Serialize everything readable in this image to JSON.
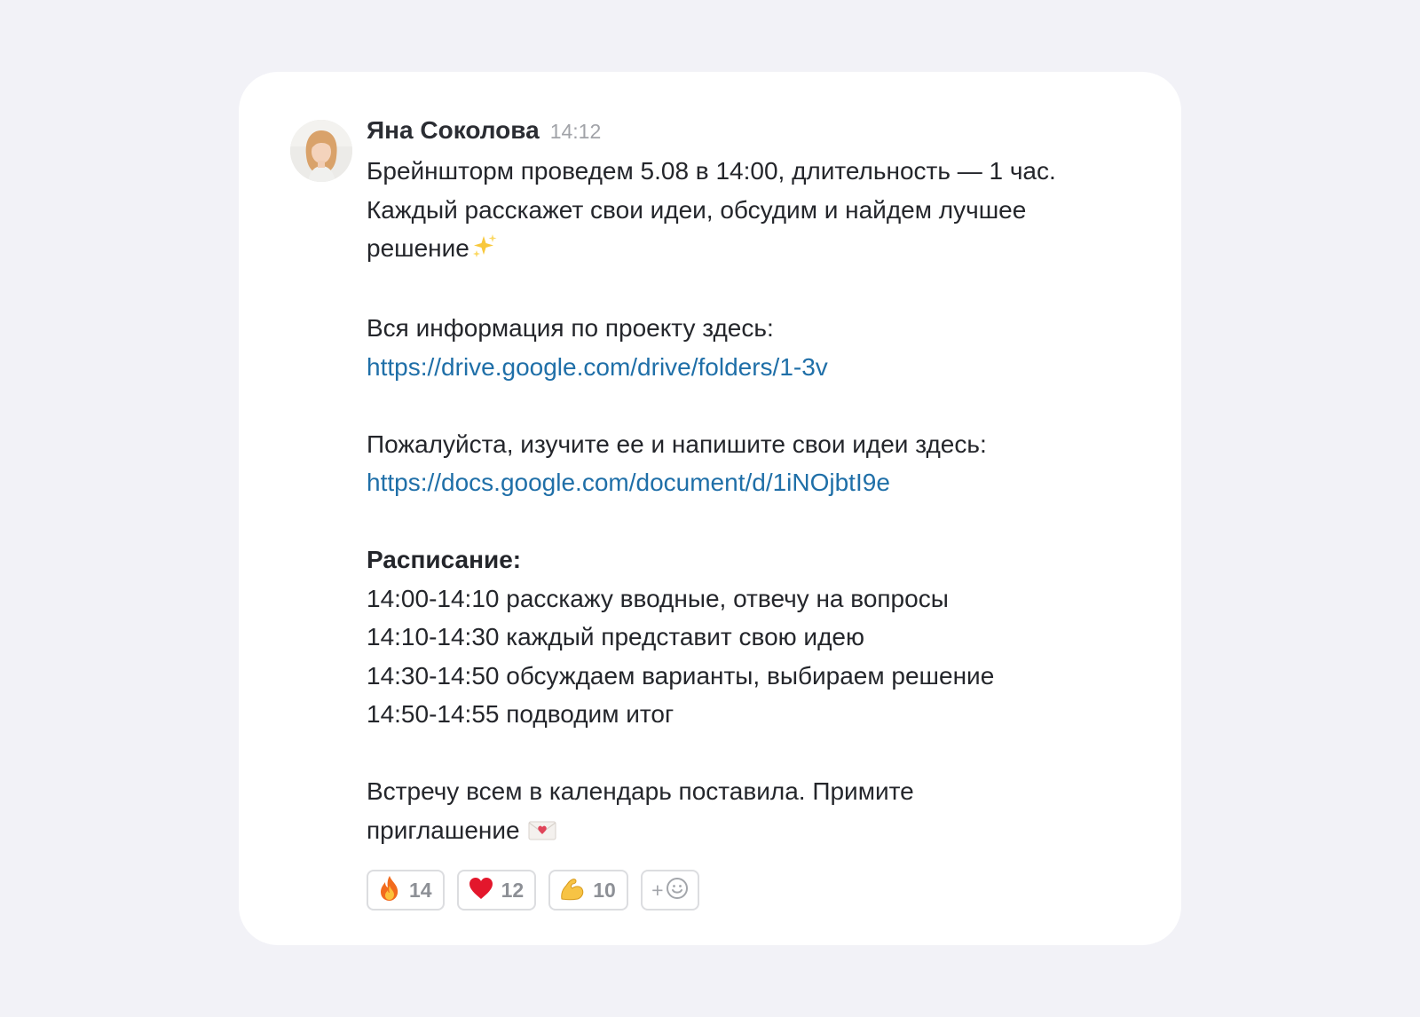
{
  "message": {
    "author": "Яна Соколова",
    "time": "14:12",
    "avatar_icon": "avatar-photo",
    "intro": [
      "Брейншторм проведем 5.08 в 14:00, длительность — 1 час.",
      "Каждый расскажет свои идеи, обсудим и найдем лучшее",
      "решение"
    ],
    "intro_emoji": "sparkles-icon",
    "info_text": "Вся информация по проекту здесь:",
    "info_link": "https://drive.google.com/drive/folders/1-3v",
    "ideas_text": "Пожалуйста, изучите ее и напишите свои идеи здесь:",
    "ideas_link": "https://docs.google.com/document/d/1iNOjbtI9e",
    "schedule_title": "Расписание:",
    "schedule": [
      "14:00-14:10 расскажу вводные, отвечу на вопросы",
      "14:10-14:30 каждый представит свою идею",
      "14:30-14:50 обсуждаем варианты, выбираем решение",
      "14:50-14:55 подводим итог"
    ],
    "closing": [
      "Встречу всем в календарь поставила. Примите",
      "приглашение"
    ],
    "closing_emoji": "love-letter-icon"
  },
  "reactions": [
    {
      "icon": "fire-icon",
      "count": "14"
    },
    {
      "icon": "heart-icon",
      "count": "12"
    },
    {
      "icon": "flexed-biceps-icon",
      "count": "10"
    }
  ],
  "add_reaction": {
    "label": "+",
    "icon": "smiley-icon"
  },
  "colors": {
    "background": "#f2f2f7",
    "card": "#ffffff",
    "link": "#1f6fa8",
    "text": "#24262b",
    "muted": "#a1a3a8"
  }
}
